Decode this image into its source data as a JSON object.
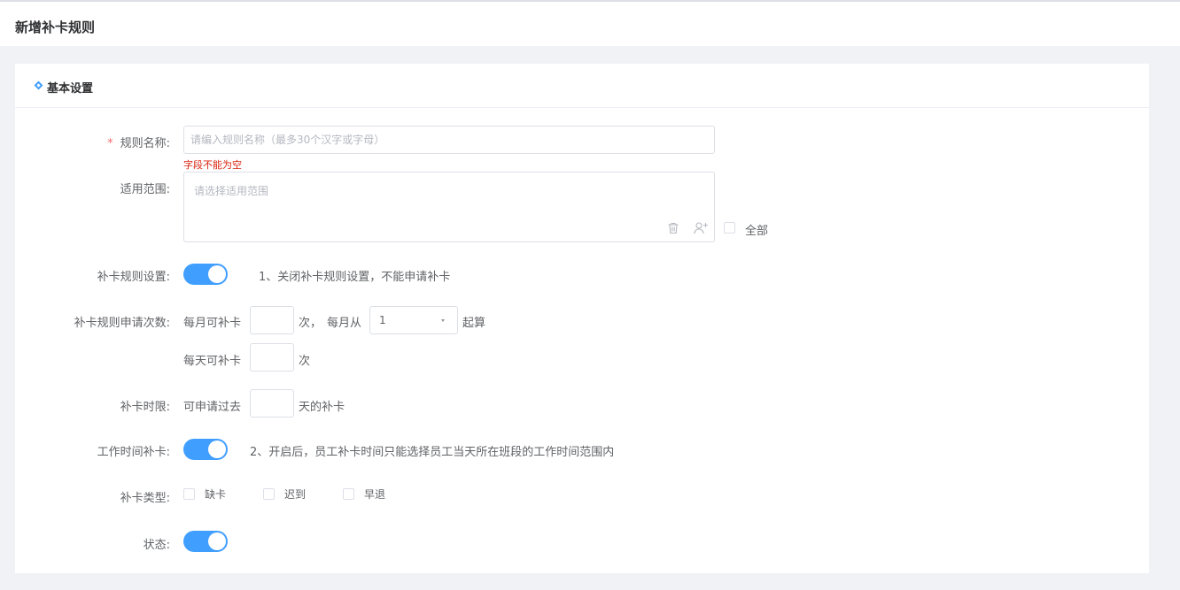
{
  "page": {
    "title": "新增补卡规则"
  },
  "section": {
    "title": "基本设置"
  },
  "form": {
    "rule_name": {
      "required_mark": "*",
      "label": "规则名称:",
      "placeholder": "请编入规则名称（最多30个汉字或字母）",
      "value": "",
      "error": "字段不能为空"
    },
    "scope": {
      "label": "适用范围:",
      "placeholder": "请选择适用范围",
      "all_label": "全部"
    },
    "rule_setting": {
      "label": "补卡规则设置:",
      "enabled": true,
      "hint": "1、关闭补卡规则设置，不能申请补卡"
    },
    "apply_count": {
      "label": "补卡规则申请次数:",
      "monthly_prefix": "每月可补卡",
      "monthly_suffix": "次，",
      "from_prefix": "每月从",
      "from_value": "1",
      "from_suffix": "起算",
      "daily_prefix": "每天可补卡",
      "daily_suffix": "次"
    },
    "time_limit": {
      "label": "补卡时限:",
      "prefix": "可申请过去",
      "suffix": "天的补卡"
    },
    "work_time": {
      "label": "工作时间补卡:",
      "enabled": true,
      "hint": "2、开启后，员工补卡时间只能选择员工当天所在班段的工作时间范围内"
    },
    "types": {
      "label": "补卡类型:",
      "options": [
        "缺卡",
        "迟到",
        "早退"
      ]
    },
    "status": {
      "label": "状态:",
      "enabled": true
    }
  }
}
